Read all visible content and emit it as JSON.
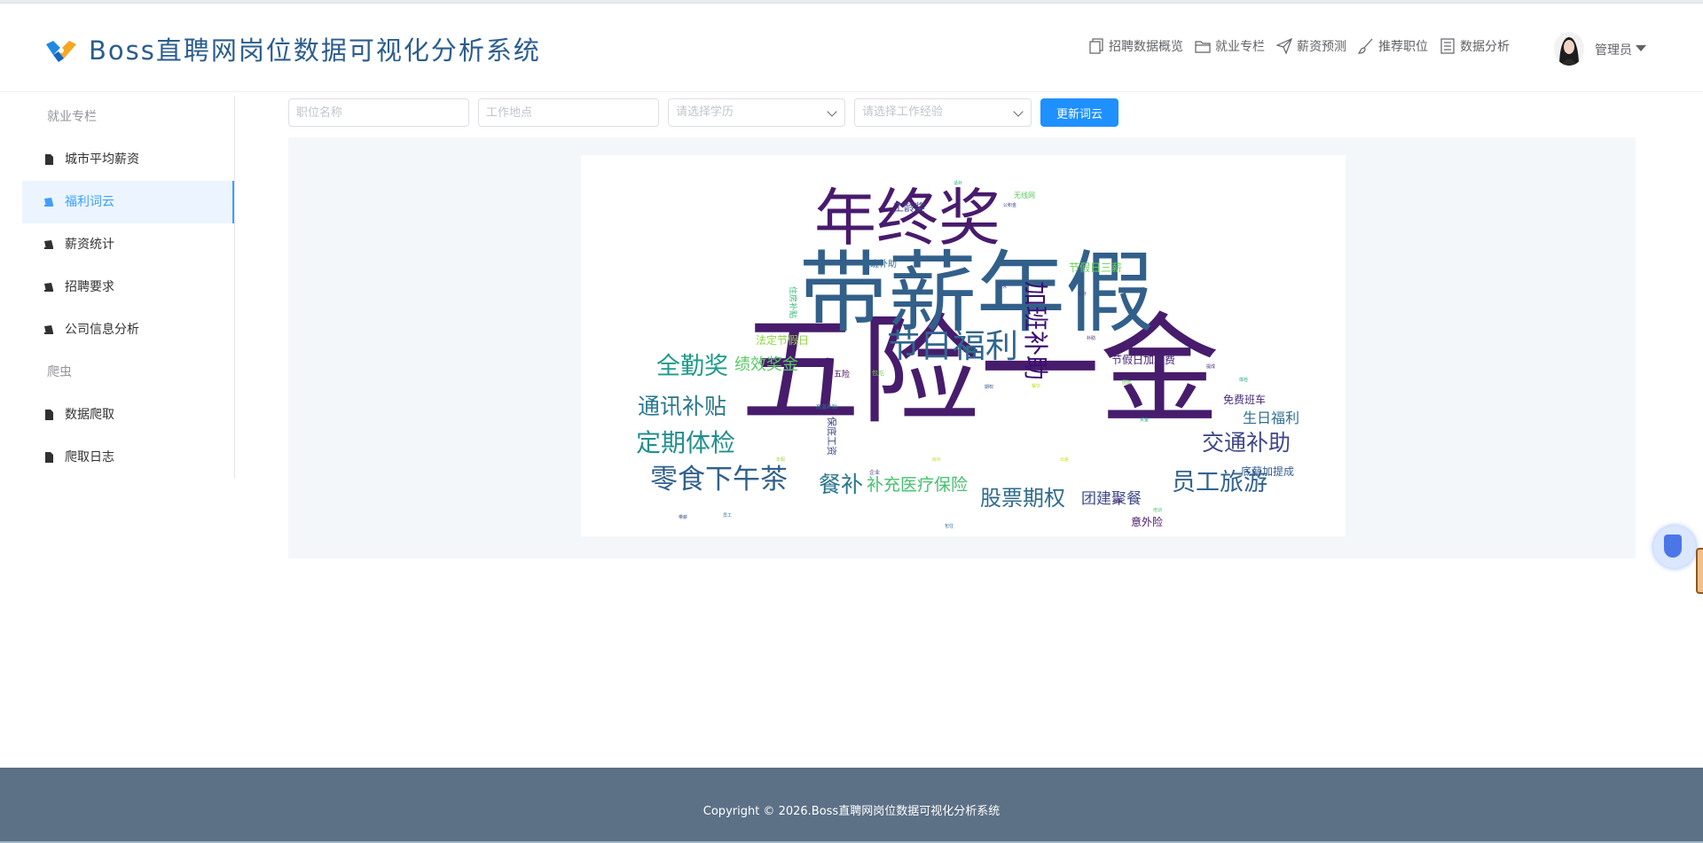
{
  "app": {
    "title": "Boss直聘网岗位数据可视化分析系统"
  },
  "nav": [
    {
      "label": "招聘数据概览",
      "icon": "document-copy-icon"
    },
    {
      "label": "就业专栏",
      "icon": "folder-icon"
    },
    {
      "label": "薪资预测",
      "icon": "paper-plane-icon"
    },
    {
      "label": "推荐职位",
      "icon": "brush-icon"
    },
    {
      "label": "数据分析",
      "icon": "list-icon"
    }
  ],
  "user": {
    "name": "管理员",
    "avatar_icon": "user-avatar"
  },
  "sidebar": {
    "group1": "就业专栏",
    "items1": [
      {
        "label": "城市平均薪资",
        "icon": "document-icon"
      },
      {
        "label": "福利词云",
        "icon": "notebook-icon"
      },
      {
        "label": "薪资统计",
        "icon": "notebook-icon"
      },
      {
        "label": "招聘要求",
        "icon": "notebook-icon"
      },
      {
        "label": "公司信息分析",
        "icon": "notebook-icon"
      }
    ],
    "group2": "爬虫",
    "items2": [
      {
        "label": "数据爬取",
        "icon": "document-icon"
      },
      {
        "label": "爬取日志",
        "icon": "document-icon"
      }
    ],
    "active_item": "福利词云"
  },
  "filters": {
    "job_placeholder": "职位名称",
    "location_placeholder": "工作地点",
    "education_placeholder": "请选择学历",
    "experience_placeholder": "请选择工作经验",
    "update_label": "更新词云"
  },
  "wordcloud": {
    "words": [
      {
        "text": "五险一金",
        "color": "#471c6c"
      },
      {
        "text": "带薪年假",
        "color": "#32608a"
      },
      {
        "text": "年终奖",
        "color": "#481b6d"
      },
      {
        "text": "节日福利",
        "color": "#31668e"
      },
      {
        "text": "加班补助",
        "color": "#3b0f70"
      },
      {
        "text": "全勤奖",
        "color": "#1f9a8a"
      },
      {
        "text": "绩效奖金",
        "color": "#58c765"
      },
      {
        "text": "通讯补贴",
        "color": "#2a788e"
      },
      {
        "text": "定期体检",
        "color": "#21908d"
      },
      {
        "text": "零食下午茶",
        "color": "#31608b"
      },
      {
        "text": "餐补",
        "color": "#2a768e"
      },
      {
        "text": "补充医疗保险",
        "color": "#46c06f"
      },
      {
        "text": "股票期权",
        "color": "#2f6b8e"
      },
      {
        "text": "团建聚餐",
        "color": "#3e4a89"
      },
      {
        "text": "员工旅游",
        "color": "#33638d"
      },
      {
        "text": "交通补助",
        "color": "#3f4788"
      },
      {
        "text": "生日福利",
        "color": "#2d708e"
      },
      {
        "text": "免费班车",
        "color": "#472d7b"
      },
      {
        "text": "底薪加提成",
        "color": "#365c8d"
      },
      {
        "text": "意外险",
        "color": "#471365"
      },
      {
        "text": "节假日三薪",
        "color": "#6ece58"
      },
      {
        "text": "节假日加班费",
        "color": "#482475"
      },
      {
        "text": "工龄奖",
        "color": "#3e4989"
      },
      {
        "text": "夜班补助",
        "color": "#31688e"
      },
      {
        "text": "法定节假日",
        "color": "#8fd744"
      },
      {
        "text": "住房补贴",
        "color": "#35b779"
      },
      {
        "text": "保底工资",
        "color": "#3e4a89"
      },
      {
        "text": "五险",
        "color": "#440154"
      },
      {
        "text": "包吃",
        "color": "#7ad151"
      },
      {
        "text": "高温补贴",
        "color": "#2c728e"
      },
      {
        "text": "补贴",
        "color": "#1f9e89"
      },
      {
        "text": "无线网",
        "color": "#5ec962"
      },
      {
        "text": "公积金",
        "color": "#404688"
      },
      {
        "text": "企业",
        "color": "#433e85"
      },
      {
        "text": "年假",
        "color": "#a0da39"
      },
      {
        "text": "带薪",
        "color": "#3b528b"
      },
      {
        "text": "包住",
        "color": "#2d708e"
      },
      {
        "text": "奖金",
        "color": "#21918c"
      },
      {
        "text": "餐饮",
        "color": "#c2df23"
      },
      {
        "text": "补助",
        "color": "#482878"
      },
      {
        "text": "体检",
        "color": "#1fa187"
      },
      {
        "text": "培训",
        "color": "#4ac16d"
      },
      {
        "text": "年休",
        "color": "#3e4c8a"
      },
      {
        "text": "出差",
        "color": "#d2e21b"
      },
      {
        "text": "期权",
        "color": "#39568c"
      },
      {
        "text": "员工",
        "color": "#2c738e"
      },
      {
        "text": "团建",
        "color": "#6ccd5a"
      },
      {
        "text": "提成",
        "color": "#472c7a"
      },
      {
        "text": "话补",
        "color": "#25ab82"
      },
      {
        "text": "车补",
        "color": "#443a83"
      },
      {
        "text": "房补",
        "color": "#b5de2b"
      },
      {
        "text": "假期",
        "color": "#46075a"
      }
    ]
  },
  "footer": {
    "copyright": "Copyright © 2026.Boss直聘网岗位数据可视化分析系统"
  }
}
